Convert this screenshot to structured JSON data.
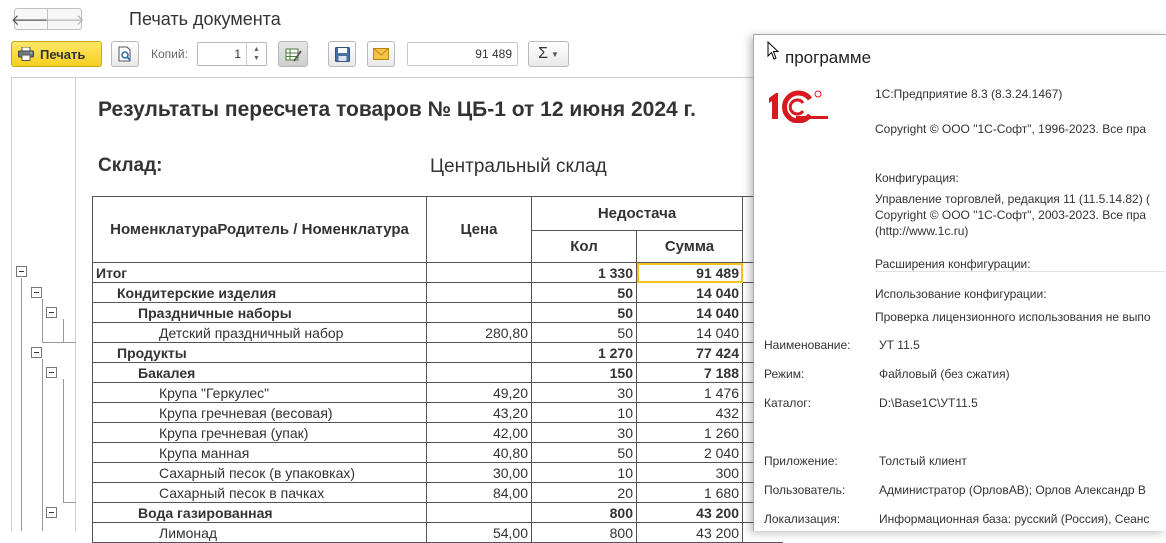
{
  "window": {
    "title": "Печать документа"
  },
  "toolbar": {
    "print_label": "Печать",
    "copies_label": "Копий:",
    "copies_value": "1",
    "sum_value": "91 489",
    "sigma_label": "Σ"
  },
  "report": {
    "title": "Результаты пересчета товаров № ЦБ-1 от 12 июня 2024 г.",
    "warehouse_label": "Склад:",
    "warehouse_value": "Центральный склад",
    "headers": {
      "item": "НоменклатураРодитель / Номенклатура",
      "price": "Цена",
      "shortage": "Недостача",
      "qty": "Кол",
      "sum": "Сумма"
    },
    "rows": [
      {
        "level": 0,
        "bold": true,
        "name": "Итог",
        "price": "",
        "qty": "1 330",
        "sum": "91 489"
      },
      {
        "level": 1,
        "bold": true,
        "name": "Кондитерские изделия",
        "price": "",
        "qty": "50",
        "sum": "14 040"
      },
      {
        "level": 2,
        "bold": true,
        "name": "Праздничные наборы",
        "price": "",
        "qty": "50",
        "sum": "14 040"
      },
      {
        "level": 3,
        "bold": false,
        "name": "Детский праздничный набор",
        "price": "280,80",
        "qty": "50",
        "sum": "14 040"
      },
      {
        "level": 1,
        "bold": true,
        "name": "Продукты",
        "price": "",
        "qty": "1 270",
        "sum": "77 424"
      },
      {
        "level": 2,
        "bold": true,
        "name": "Бакалея",
        "price": "",
        "qty": "150",
        "sum": "7 188"
      },
      {
        "level": 3,
        "bold": false,
        "name": "Крупа \"Геркулес\"",
        "price": "49,20",
        "qty": "30",
        "sum": "1 476"
      },
      {
        "level": 3,
        "bold": false,
        "name": "Крупа гречневая (весовая)",
        "price": "43,20",
        "qty": "10",
        "sum": "432"
      },
      {
        "level": 3,
        "bold": false,
        "name": "Крупа гречневая (упак)",
        "price": "42,00",
        "qty": "30",
        "sum": "1 260"
      },
      {
        "level": 3,
        "bold": false,
        "name": "Крупа манная",
        "price": "40,80",
        "qty": "50",
        "sum": "2 040"
      },
      {
        "level": 3,
        "bold": false,
        "name": "Сахарный песок (в упаковках)",
        "price": "30,00",
        "qty": "10",
        "sum": "300"
      },
      {
        "level": 3,
        "bold": false,
        "name": "Сахарный песок в пачках",
        "price": "84,00",
        "qty": "20",
        "sum": "1 680"
      },
      {
        "level": 2,
        "bold": true,
        "name": "Вода газированная",
        "price": "",
        "qty": "800",
        "sum": "43 200"
      },
      {
        "level": 3,
        "bold": false,
        "name": "Лимонад",
        "price": "54,00",
        "qty": "800",
        "sum": "43 200"
      }
    ]
  },
  "about": {
    "title": "программе",
    "version": "1С:Предприятие 8.3 (8.3.24.1467)",
    "copyright": "Copyright © ООО \"1С-Софт\", 1996-2023. Все пра",
    "config_label": "Конфигурация:",
    "config_name": "Управление торговлей, редакция 11 (11.5.14.82) (",
    "config_copyright": "Copyright © ООО \"1С-Софт\", 2003-2023. Все пра",
    "config_url": "(http://www.1c.ru)",
    "extensions_label": "Расширения конфигурации:",
    "usage_label": "Использование конфигурации:",
    "license_check": "Проверка лицензионного использования не выпо",
    "fields": [
      {
        "label": "Наименование:",
        "value": "УТ 11.5"
      },
      {
        "label": "Режим:",
        "value": "Файловый (без сжатия)"
      },
      {
        "label": "Каталог:",
        "value": "D:\\Base1C\\УТ11.5"
      },
      {
        "label": "Приложение:",
        "value": "Толстый клиент"
      },
      {
        "label": "Пользователь:",
        "value": "Администратор (ОрловАВ); Орлов Александр В"
      },
      {
        "label": "Локализация:",
        "value": "Информационная база: русский (Россия), Сеанс"
      }
    ]
  },
  "colors": {
    "print_button": "#f5cf1f",
    "logo_red": "#d71920",
    "highlight": "#f0c419"
  }
}
